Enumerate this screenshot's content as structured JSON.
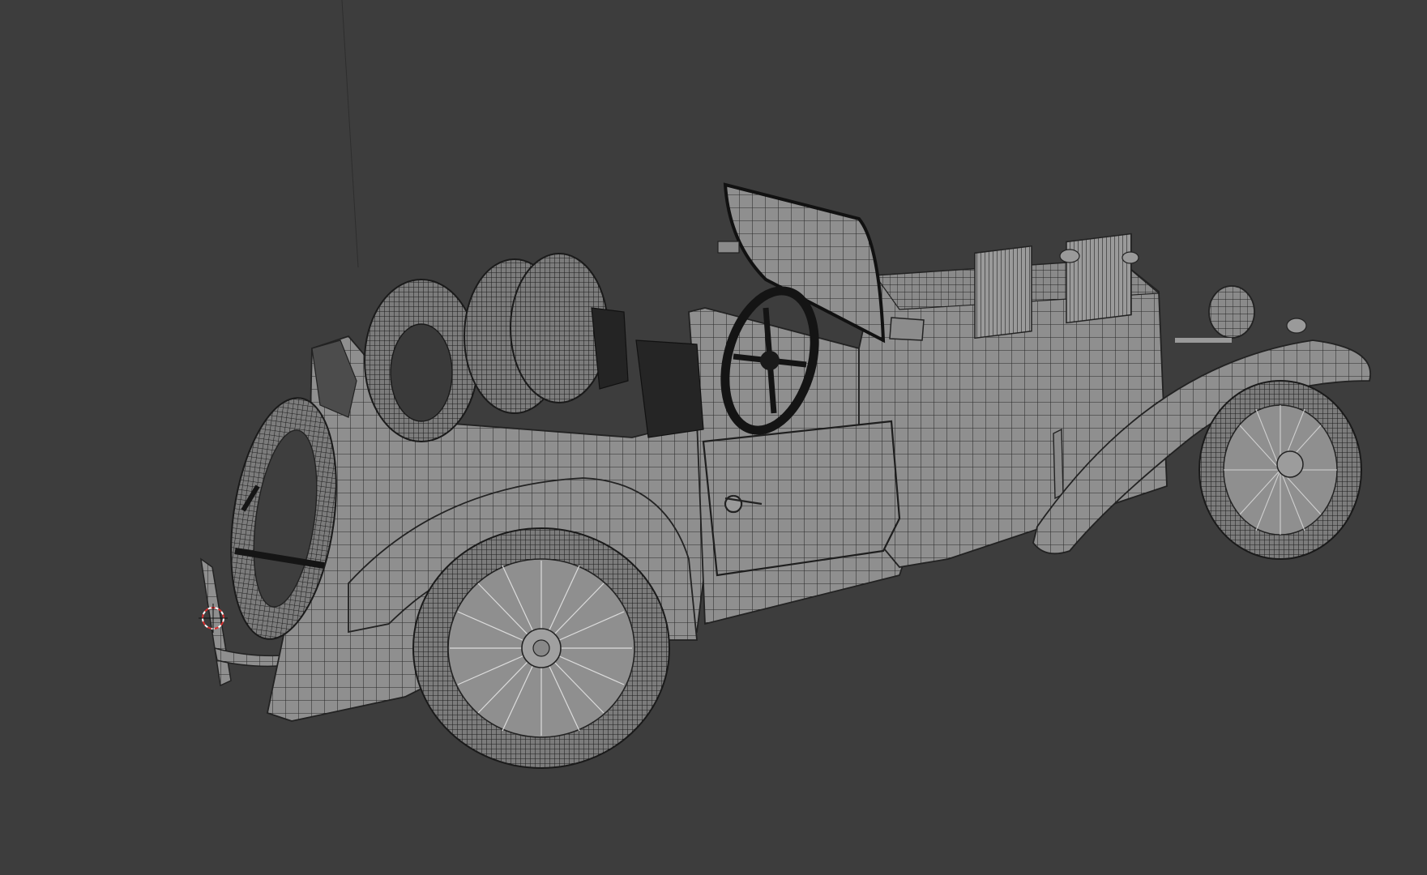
{
  "viewport": {
    "background": "#3d3d3d",
    "model_fill": "#8e8e8e",
    "model_fill_shadow": "#6f6f6f",
    "wire_color": "#2a2a2a",
    "tire_dark": "#1c1c1c",
    "cursor_colors": [
      "#ffffff",
      "#d83030"
    ]
  },
  "objects": [
    {
      "name": "car-body",
      "icon": "mesh"
    },
    {
      "name": "windscreen",
      "icon": "mesh"
    },
    {
      "name": "steering-wheel",
      "icon": "mesh"
    },
    {
      "name": "spare-tires",
      "icon": "mesh"
    },
    {
      "name": "front-wheel",
      "icon": "mesh"
    },
    {
      "name": "rear-wheel",
      "icon": "mesh"
    },
    {
      "name": "3d-cursor",
      "icon": "cursor"
    }
  ]
}
